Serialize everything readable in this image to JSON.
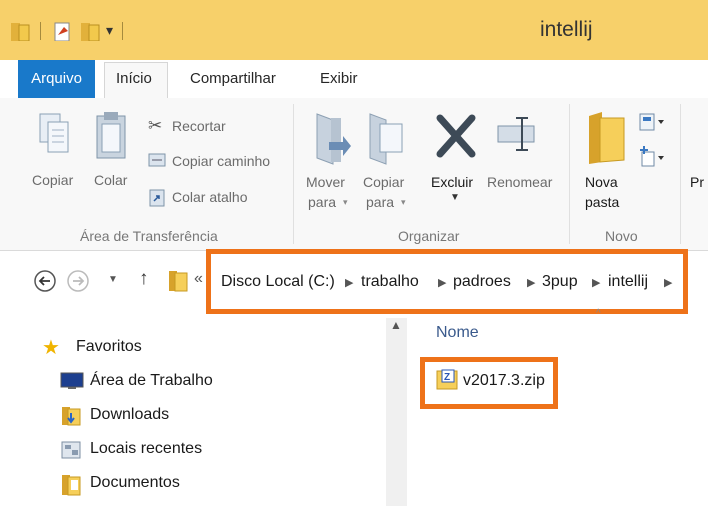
{
  "window": {
    "title": "intellij"
  },
  "tabs": [
    {
      "label": "Arquivo"
    },
    {
      "label": "Início"
    },
    {
      "label": "Compartilhar"
    },
    {
      "label": "Exibir"
    }
  ],
  "ribbon": {
    "clipboard": {
      "copy_label": "Copiar",
      "paste_label": "Colar",
      "cut_label": "Recortar",
      "copy_path_label": "Copiar caminho",
      "paste_shortcut_label": "Colar atalho",
      "group_label": "Área de Transferência"
    },
    "organize": {
      "move_to_line1": "Mover",
      "move_to_line2": "para",
      "copy_to_line1": "Copiar",
      "copy_to_line2": "para",
      "delete_label": "Excluir",
      "rename_label": "Renomear",
      "group_label": "Organizar"
    },
    "new": {
      "new_folder_line1": "Nova",
      "new_folder_line2": "pasta",
      "group_label": "Novo"
    },
    "open": {
      "properties_label_clipped": "Pr"
    }
  },
  "address_bar": {
    "path": [
      "Disco Local (C:)",
      "trabalho",
      "padroes",
      "3pup",
      "intellij"
    ],
    "overflow": "«"
  },
  "nav_pane": {
    "favorites_label": "Favoritos",
    "items": [
      {
        "label": "Área de Trabalho",
        "icon": "desktop-icon"
      },
      {
        "label": "Downloads",
        "icon": "downloads-icon"
      },
      {
        "label": "Locais recentes",
        "icon": "recent-places-icon"
      },
      {
        "label": "Documentos",
        "icon": "documents-icon"
      }
    ]
  },
  "file_list": {
    "column_header": "Nome",
    "files": [
      {
        "name": "v2017.3.zip",
        "icon": "zip-archive-icon"
      }
    ]
  },
  "colors": {
    "highlight": "#ee7219",
    "titlebar": "#f7d06a",
    "accent": "#1979ca"
  }
}
